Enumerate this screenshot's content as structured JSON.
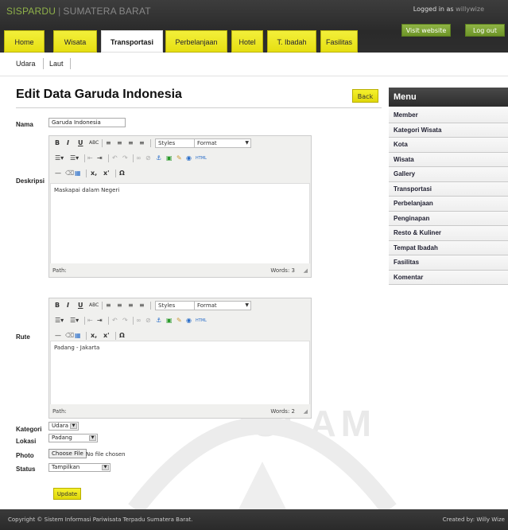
{
  "header": {
    "brand_main": "SISPARDU",
    "brand_sep": "|",
    "brand_sub": "SUMATERA BARAT",
    "logged_in_prefix": "Logged in as",
    "user": "willywize",
    "visit_label": "Visit website",
    "logout_label": "Log out"
  },
  "nav": {
    "tabs": [
      {
        "label": "Home"
      },
      {
        "label": "Wisata"
      },
      {
        "label": "Transportasi"
      },
      {
        "label": "Perbelanjaan"
      },
      {
        "label": "Hotel"
      },
      {
        "label": "T. Ibadah"
      },
      {
        "label": "Fasilitas"
      }
    ],
    "active": "Transportasi"
  },
  "subnav": {
    "items": [
      {
        "label": "Udara"
      },
      {
        "label": "Laut"
      }
    ]
  },
  "page": {
    "title": "Edit Data Garuda Indonesia",
    "back_label": "Back"
  },
  "form": {
    "nama_label": "Nama",
    "nama_value": "Garuda Indonesia",
    "deskripsi_label": "Deskripsi",
    "deskripsi_text": "Maskapai dalam Negeri",
    "deskripsi_words": "Words: 3",
    "rute_label": "Rute",
    "rute_text": "Padang - Jakarta",
    "rute_words": "Words: 2",
    "path_label": "Path:",
    "toolbar": {
      "bold": "B",
      "italic": "I",
      "underline": "U",
      "strike": "ABC",
      "styles": "Styles",
      "format": "Format",
      "subscript": "x,",
      "superscript": "x'",
      "omega": "Ω"
    },
    "kategori_label": "Kategori",
    "kategori_value": "Udara",
    "lokasi_label": "Lokasi",
    "lokasi_value": "Padang",
    "photo_label": "Photo",
    "choose_file_label": "Choose File",
    "no_file_label": "No file chosen",
    "status_label": "Status",
    "status_value": "Tampilkan",
    "update_label": "Update"
  },
  "sidebar": {
    "title": "Menu",
    "items": [
      {
        "label": "Member"
      },
      {
        "label": "Kategori Wisata"
      },
      {
        "label": "Kota"
      },
      {
        "label": "Wisata"
      },
      {
        "label": "Gallery"
      },
      {
        "label": "Transportasi"
      },
      {
        "label": "Perbelanjaan"
      },
      {
        "label": "Penginapan"
      },
      {
        "label": "Resto & Kuliner"
      },
      {
        "label": "Tempat Ibadah"
      },
      {
        "label": "Fasilitas"
      },
      {
        "label": "Komentar"
      }
    ]
  },
  "watermark": {
    "text": "ISLAM"
  },
  "footer": {
    "copyright": "Copyright © Sistem Informasi Pariwisata Terpadu Sumatera Barat.",
    "created": "Created by: Willy Wize"
  },
  "colors": {
    "tab_yellow": "#f3ef3a",
    "brand_green": "#8fb14a",
    "header_dark": "#2a2a2a",
    "button_green": "#7aa233"
  }
}
